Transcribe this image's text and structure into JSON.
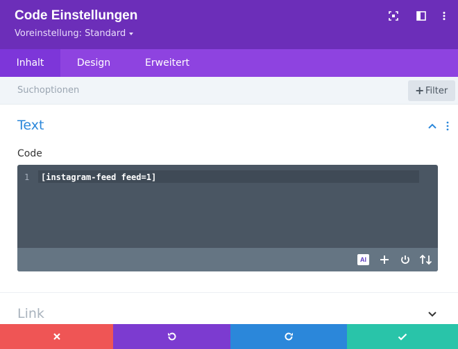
{
  "header": {
    "title": "Code Einstellungen",
    "preset_label": "Voreinstellung: Standard",
    "icons": [
      "expand-icon",
      "sidebar-layout-icon",
      "more-vertical-icon"
    ]
  },
  "tabs": [
    {
      "label": "Inhalt",
      "active": true
    },
    {
      "label": "Design",
      "active": false
    },
    {
      "label": "Erweitert",
      "active": false
    }
  ],
  "search": {
    "placeholder": "Suchoptionen",
    "filter_label": "Filter"
  },
  "section_text": {
    "title": "Text",
    "code_label": "Code",
    "editor": {
      "line_number": "1",
      "code": "[instagram-feed feed=1]",
      "ai_label": "AI"
    }
  },
  "section_link": {
    "title": "Link"
  },
  "footer": {
    "colors": {
      "cancel": "#ef5555",
      "undo": "#7c3bd0",
      "redo": "#2b87da",
      "save": "#29c4a9"
    }
  },
  "colors": {
    "header": "#6c2eb9",
    "tabs": "#8e43e0",
    "accent": "#2b87da"
  }
}
